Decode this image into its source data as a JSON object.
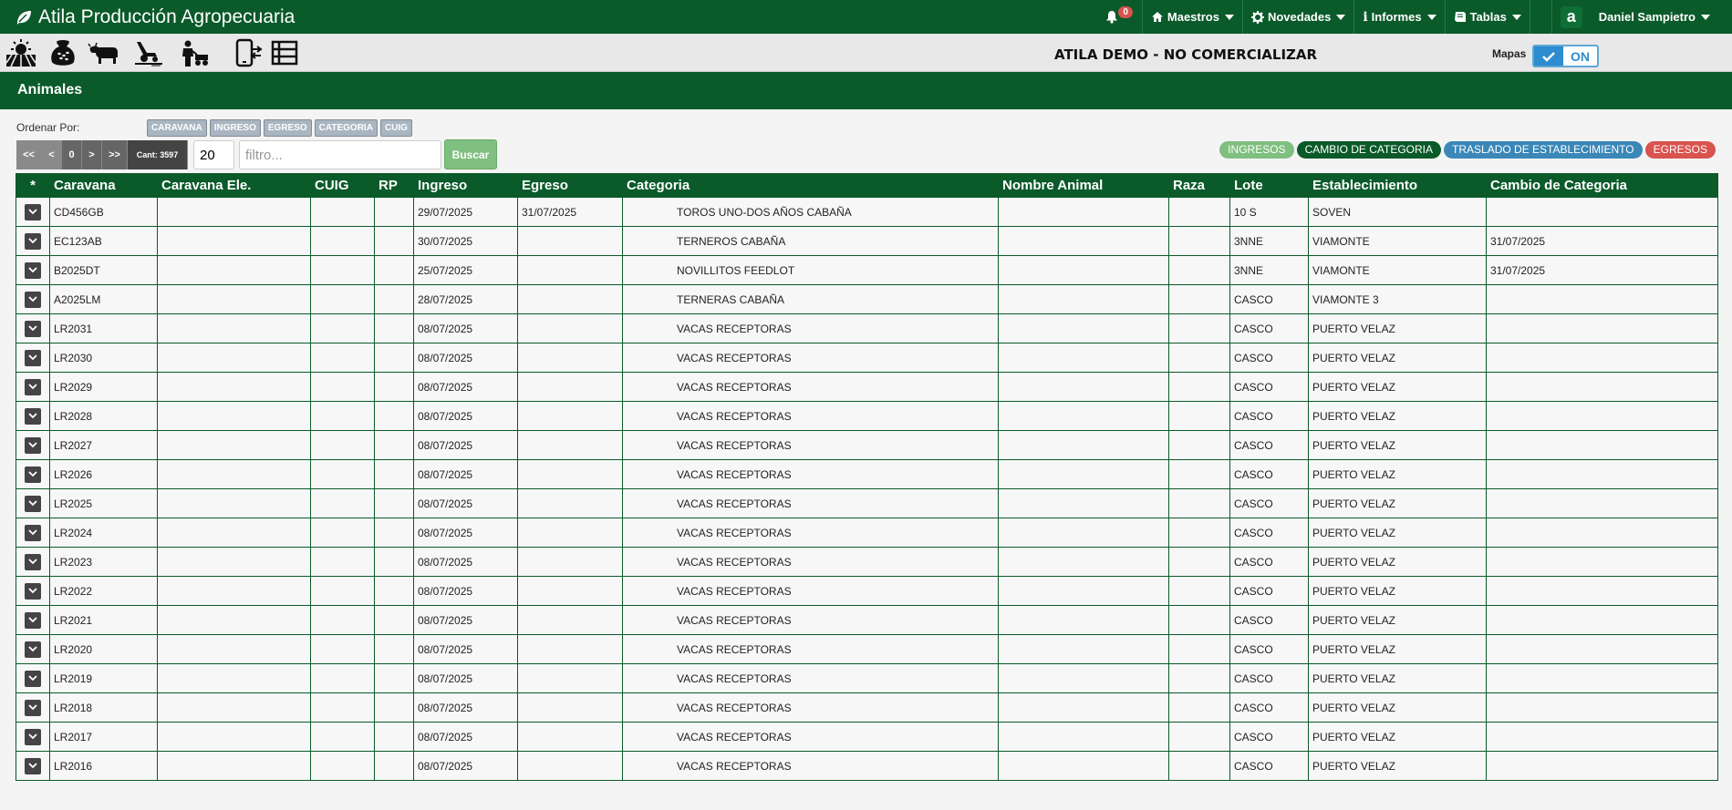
{
  "app": {
    "title": "Atila Producción Agropecuaria",
    "notifications": "0",
    "menus": [
      "Maestros",
      "Novedades",
      "Informes",
      "Tablas"
    ],
    "user": "Daniel Sampietro"
  },
  "toolbar": {
    "icons": [
      "farm-field-icon",
      "seed-bag-icon",
      "cow-icon",
      "tractor-icon",
      "worker-icon",
      "mobile-transfer-icon",
      "list-table-icon"
    ],
    "demo_title": "ATILA DEMO - NO COMERCIALIZAR",
    "mapas_label": "Mapas",
    "mapas_state": "ON"
  },
  "section": {
    "title": "Animales"
  },
  "controls": {
    "ordenar_label": "Ordenar Por:",
    "sort_buttons": [
      "CARAVANA",
      "INGRESO",
      "EGRESO",
      "CATEGORIA",
      "CUIG"
    ],
    "pager": [
      "<<",
      "<",
      "0",
      ">",
      ">>"
    ],
    "cant": "Cant: 3597",
    "page_size": "20",
    "filter_placeholder": "filtro...",
    "buscar": "Buscar"
  },
  "pills": [
    {
      "label": "INGRESOS",
      "color": "#7fbf7f"
    },
    {
      "label": "CAMBIO DE CATEGORIA",
      "color": "#0a5a2a"
    },
    {
      "label": "TRASLADO DE ESTABLECIMIENTO",
      "color": "#3b87b8"
    },
    {
      "label": "EGRESOS",
      "color": "#d9534f"
    }
  ],
  "table": {
    "headers": [
      "*",
      "Caravana",
      "Caravana Ele.",
      "CUIG",
      "RP",
      "Ingreso",
      "Egreso",
      "Categoria",
      "Nombre Animal",
      "Raza",
      "Lote",
      "Establecimiento",
      "Cambio de Categoria"
    ],
    "rows": [
      [
        "CD456GB",
        "",
        "",
        "",
        "29/07/2025",
        "31/07/2025",
        "TOROS UNO-DOS AÑOS CABAÑA",
        "",
        "",
        "10 S",
        "SOVEN",
        ""
      ],
      [
        "EC123AB",
        "",
        "",
        "",
        "30/07/2025",
        "",
        "TERNEROS CABAÑA",
        "",
        "",
        "3NNE",
        "VIAMONTE",
        "31/07/2025"
      ],
      [
        "B2025DT",
        "",
        "",
        "",
        "25/07/2025",
        "",
        "NOVILLITOS FEEDLOT",
        "",
        "",
        "3NNE",
        "VIAMONTE",
        "31/07/2025"
      ],
      [
        "A2025LM",
        "",
        "",
        "",
        "28/07/2025",
        "",
        "TERNERAS CABAÑA",
        "",
        "",
        "CASCO",
        "VIAMONTE 3",
        ""
      ],
      [
        "LR2031",
        "",
        "",
        "",
        "08/07/2025",
        "",
        "VACAS RECEPTORAS",
        "",
        "",
        "CASCO",
        "PUERTO VELAZ",
        ""
      ],
      [
        "LR2030",
        "",
        "",
        "",
        "08/07/2025",
        "",
        "VACAS RECEPTORAS",
        "",
        "",
        "CASCO",
        "PUERTO VELAZ",
        ""
      ],
      [
        "LR2029",
        "",
        "",
        "",
        "08/07/2025",
        "",
        "VACAS RECEPTORAS",
        "",
        "",
        "CASCO",
        "PUERTO VELAZ",
        ""
      ],
      [
        "LR2028",
        "",
        "",
        "",
        "08/07/2025",
        "",
        "VACAS RECEPTORAS",
        "",
        "",
        "CASCO",
        "PUERTO VELAZ",
        ""
      ],
      [
        "LR2027",
        "",
        "",
        "",
        "08/07/2025",
        "",
        "VACAS RECEPTORAS",
        "",
        "",
        "CASCO",
        "PUERTO VELAZ",
        ""
      ],
      [
        "LR2026",
        "",
        "",
        "",
        "08/07/2025",
        "",
        "VACAS RECEPTORAS",
        "",
        "",
        "CASCO",
        "PUERTO VELAZ",
        ""
      ],
      [
        "LR2025",
        "",
        "",
        "",
        "08/07/2025",
        "",
        "VACAS RECEPTORAS",
        "",
        "",
        "CASCO",
        "PUERTO VELAZ",
        ""
      ],
      [
        "LR2024",
        "",
        "",
        "",
        "08/07/2025",
        "",
        "VACAS RECEPTORAS",
        "",
        "",
        "CASCO",
        "PUERTO VELAZ",
        ""
      ],
      [
        "LR2023",
        "",
        "",
        "",
        "08/07/2025",
        "",
        "VACAS RECEPTORAS",
        "",
        "",
        "CASCO",
        "PUERTO VELAZ",
        ""
      ],
      [
        "LR2022",
        "",
        "",
        "",
        "08/07/2025",
        "",
        "VACAS RECEPTORAS",
        "",
        "",
        "CASCO",
        "PUERTO VELAZ",
        ""
      ],
      [
        "LR2021",
        "",
        "",
        "",
        "08/07/2025",
        "",
        "VACAS RECEPTORAS",
        "",
        "",
        "CASCO",
        "PUERTO VELAZ",
        ""
      ],
      [
        "LR2020",
        "",
        "",
        "",
        "08/07/2025",
        "",
        "VACAS RECEPTORAS",
        "",
        "",
        "CASCO",
        "PUERTO VELAZ",
        ""
      ],
      [
        "LR2019",
        "",
        "",
        "",
        "08/07/2025",
        "",
        "VACAS RECEPTORAS",
        "",
        "",
        "CASCO",
        "PUERTO VELAZ",
        ""
      ],
      [
        "LR2018",
        "",
        "",
        "",
        "08/07/2025",
        "",
        "VACAS RECEPTORAS",
        "",
        "",
        "CASCO",
        "PUERTO VELAZ",
        ""
      ],
      [
        "LR2017",
        "",
        "",
        "",
        "08/07/2025",
        "",
        "VACAS RECEPTORAS",
        "",
        "",
        "CASCO",
        "PUERTO VELAZ",
        ""
      ],
      [
        "LR2016",
        "",
        "",
        "",
        "08/07/2025",
        "",
        "VACAS RECEPTORAS",
        "",
        "",
        "CASCO",
        "PUERTO VELAZ",
        ""
      ]
    ]
  }
}
